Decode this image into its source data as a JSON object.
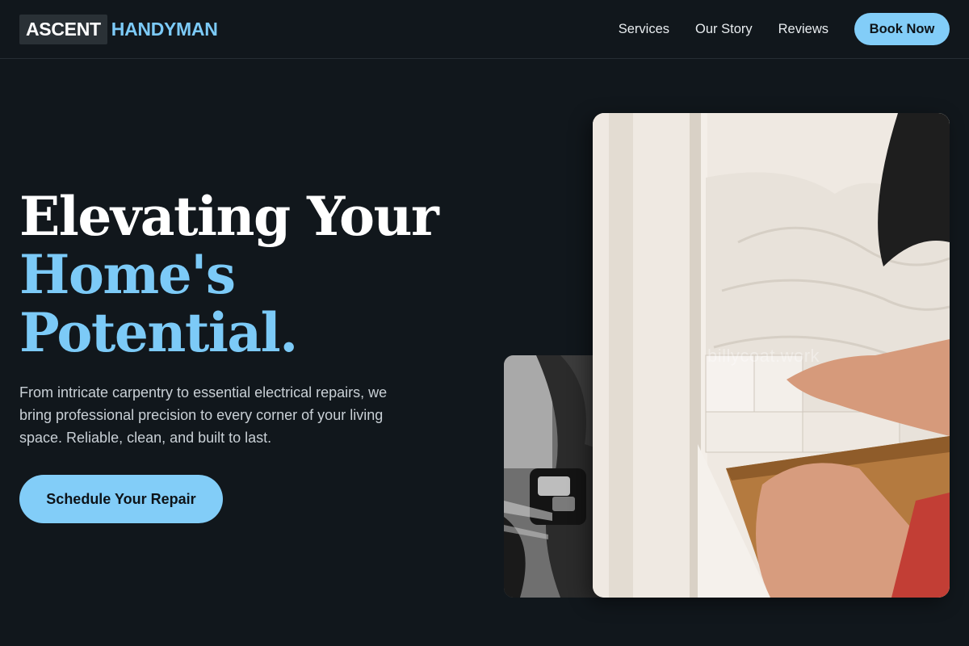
{
  "brand": {
    "box_text": "ASCENT",
    "text": "HANDYMAN",
    "accent_color": "#7ccaf7"
  },
  "nav": {
    "links": [
      "Services",
      "Our Story",
      "Reviews"
    ],
    "cta_label": "Book Now"
  },
  "hero": {
    "title_line1": "Elevating Your",
    "title_line2": "Home's",
    "title_line3": "Potential.",
    "description": "From intricate carpentry to essential electrical repairs, we bring professional precision to every corner of your living space. Reliable, clean, and built to last.",
    "cta_label": "Schedule Your Repair"
  },
  "images": {
    "small": {
      "icon": "handyman-drill-photo"
    },
    "large": {
      "icon": "tiling-wall-photo",
      "watermark": "billycoat.work"
    }
  },
  "colors": {
    "background": "#11171c",
    "accent": "#82cdf8",
    "text_primary": "#ffffff",
    "text_secondary": "#c9d0d6"
  }
}
